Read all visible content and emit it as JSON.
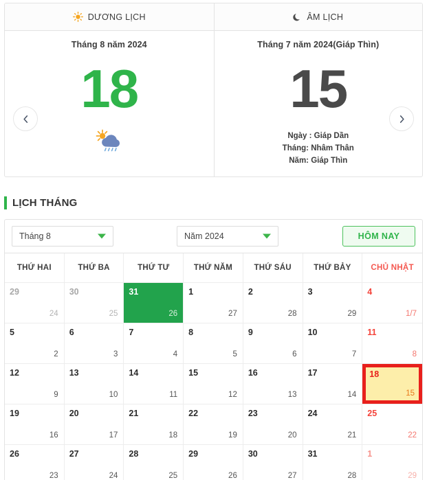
{
  "tabs": [
    {
      "label": "DƯƠNG LỊCH",
      "icon": "sun-icon"
    },
    {
      "label": "ÂM LỊCH",
      "icon": "moon-icon"
    }
  ],
  "solar_pane": {
    "title": "Tháng 8 năm 2024",
    "day": "18",
    "day_color": "#2fb44a",
    "weather_icon": "sun-rain-cloud-icon"
  },
  "lunar_pane": {
    "title": "Tháng 7 năm 2024(Giáp Thìn)",
    "day": "15",
    "day_color": "#4a4a4a",
    "info": {
      "day": "Ngày : Giáp Dần",
      "month": "Tháng: Nhâm Thân",
      "year": "Năm: Giáp Thìn"
    }
  },
  "nav": {
    "prev": "chevron-left-icon",
    "next": "chevron-right-icon"
  },
  "section": {
    "title": "LỊCH THÁNG",
    "accent": "#2fb44a"
  },
  "controls": {
    "month_select": "Tháng 8",
    "year_select": "Năm 2024",
    "today_button": "HÔM NAY"
  },
  "weekdays": [
    {
      "label": "THỨ HAI",
      "sunday": false
    },
    {
      "label": "THỨ BA",
      "sunday": false
    },
    {
      "label": "THỨ TƯ",
      "sunday": false
    },
    {
      "label": "THỨ NĂM",
      "sunday": false
    },
    {
      "label": "THỨ SÁU",
      "sunday": false
    },
    {
      "label": "THỨ BẢY",
      "sunday": false
    },
    {
      "label": "CHỦ NHẬT",
      "sunday": true
    }
  ],
  "weeks": [
    [
      {
        "solar": "29",
        "lunar": "24",
        "out": true,
        "sunday": false,
        "green": false,
        "today": false
      },
      {
        "solar": "30",
        "lunar": "25",
        "out": true,
        "sunday": false,
        "green": false,
        "today": false
      },
      {
        "solar": "31",
        "lunar": "26",
        "out": true,
        "sunday": false,
        "green": true,
        "today": false
      },
      {
        "solar": "1",
        "lunar": "27",
        "out": false,
        "sunday": false,
        "green": false,
        "today": false
      },
      {
        "solar": "2",
        "lunar": "28",
        "out": false,
        "sunday": false,
        "green": false,
        "today": false
      },
      {
        "solar": "3",
        "lunar": "29",
        "out": false,
        "sunday": false,
        "green": false,
        "today": false
      },
      {
        "solar": "4",
        "lunar": "1/7",
        "out": false,
        "sunday": true,
        "green": false,
        "today": false
      }
    ],
    [
      {
        "solar": "5",
        "lunar": "2",
        "out": false,
        "sunday": false,
        "green": false,
        "today": false
      },
      {
        "solar": "6",
        "lunar": "3",
        "out": false,
        "sunday": false,
        "green": false,
        "today": false
      },
      {
        "solar": "7",
        "lunar": "4",
        "out": false,
        "sunday": false,
        "green": false,
        "today": false
      },
      {
        "solar": "8",
        "lunar": "5",
        "out": false,
        "sunday": false,
        "green": false,
        "today": false
      },
      {
        "solar": "9",
        "lunar": "6",
        "out": false,
        "sunday": false,
        "green": false,
        "today": false
      },
      {
        "solar": "10",
        "lunar": "7",
        "out": false,
        "sunday": false,
        "green": false,
        "today": false
      },
      {
        "solar": "11",
        "lunar": "8",
        "out": false,
        "sunday": true,
        "green": false,
        "today": false
      }
    ],
    [
      {
        "solar": "12",
        "lunar": "9",
        "out": false,
        "sunday": false,
        "green": false,
        "today": false
      },
      {
        "solar": "13",
        "lunar": "10",
        "out": false,
        "sunday": false,
        "green": false,
        "today": false
      },
      {
        "solar": "14",
        "lunar": "11",
        "out": false,
        "sunday": false,
        "green": false,
        "today": false
      },
      {
        "solar": "15",
        "lunar": "12",
        "out": false,
        "sunday": false,
        "green": false,
        "today": false
      },
      {
        "solar": "16",
        "lunar": "13",
        "out": false,
        "sunday": false,
        "green": false,
        "today": false
      },
      {
        "solar": "17",
        "lunar": "14",
        "out": false,
        "sunday": false,
        "green": false,
        "today": false
      },
      {
        "solar": "18",
        "lunar": "15",
        "out": false,
        "sunday": true,
        "green": false,
        "today": true
      }
    ],
    [
      {
        "solar": "19",
        "lunar": "16",
        "out": false,
        "sunday": false,
        "green": false,
        "today": false
      },
      {
        "solar": "20",
        "lunar": "17",
        "out": false,
        "sunday": false,
        "green": false,
        "today": false
      },
      {
        "solar": "21",
        "lunar": "18",
        "out": false,
        "sunday": false,
        "green": false,
        "today": false
      },
      {
        "solar": "22",
        "lunar": "19",
        "out": false,
        "sunday": false,
        "green": false,
        "today": false
      },
      {
        "solar": "23",
        "lunar": "20",
        "out": false,
        "sunday": false,
        "green": false,
        "today": false
      },
      {
        "solar": "24",
        "lunar": "21",
        "out": false,
        "sunday": false,
        "green": false,
        "today": false
      },
      {
        "solar": "25",
        "lunar": "22",
        "out": false,
        "sunday": true,
        "green": false,
        "today": false
      }
    ],
    [
      {
        "solar": "26",
        "lunar": "23",
        "out": false,
        "sunday": false,
        "green": false,
        "today": false
      },
      {
        "solar": "27",
        "lunar": "24",
        "out": false,
        "sunday": false,
        "green": false,
        "today": false
      },
      {
        "solar": "28",
        "lunar": "25",
        "out": false,
        "sunday": false,
        "green": false,
        "today": false
      },
      {
        "solar": "29",
        "lunar": "26",
        "out": false,
        "sunday": false,
        "green": false,
        "today": false
      },
      {
        "solar": "30",
        "lunar": "27",
        "out": false,
        "sunday": false,
        "green": false,
        "today": false
      },
      {
        "solar": "31",
        "lunar": "28",
        "out": false,
        "sunday": false,
        "green": false,
        "today": false
      },
      {
        "solar": "1",
        "lunar": "29",
        "out": true,
        "sunday": true,
        "green": false,
        "today": false
      }
    ]
  ]
}
